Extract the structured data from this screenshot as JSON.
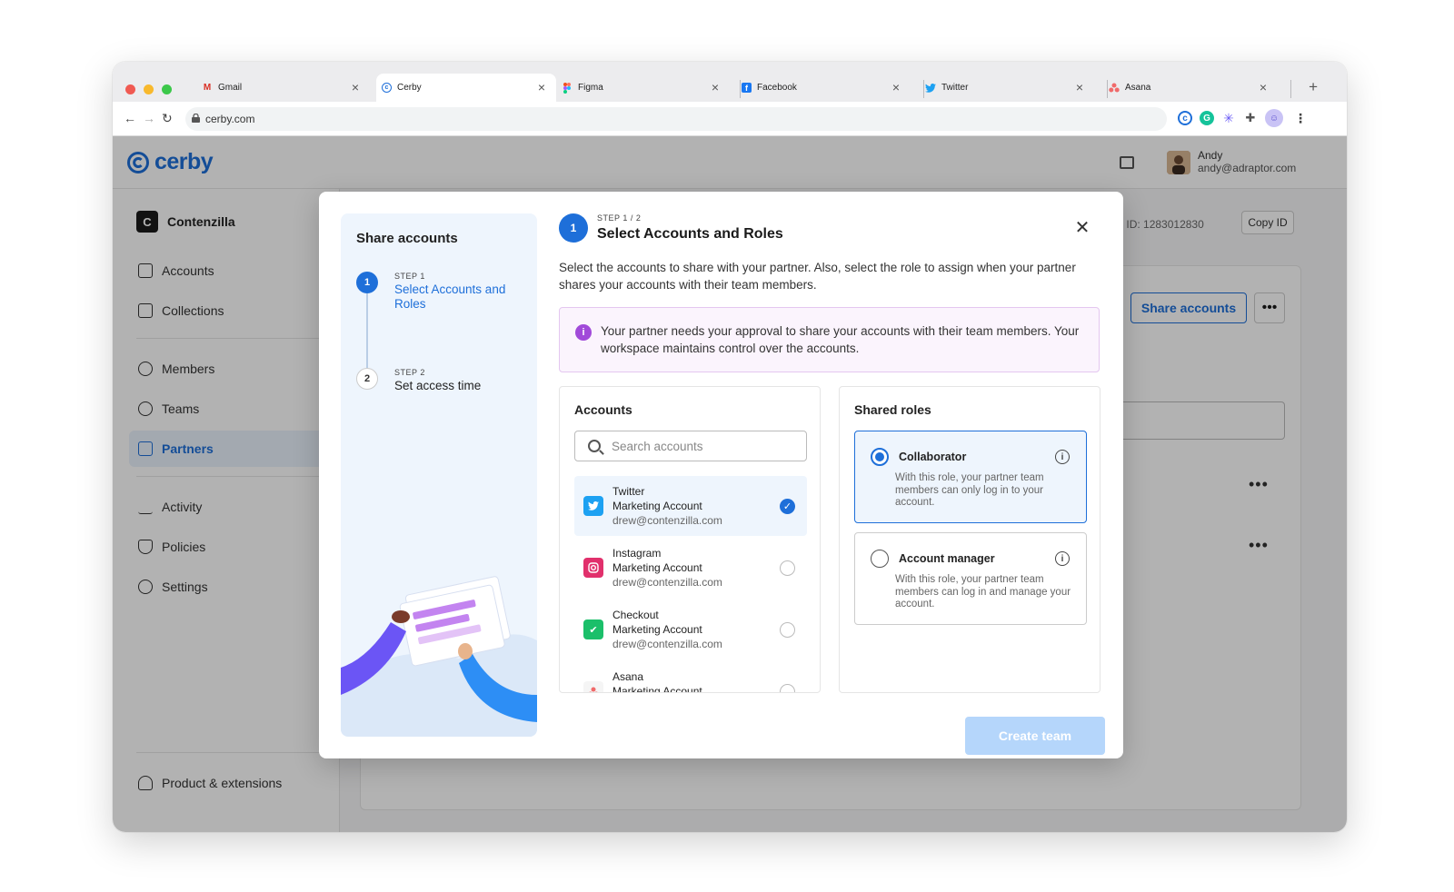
{
  "browser": {
    "tabs": [
      {
        "label": "Gmail",
        "favicon": "gmail-icon"
      },
      {
        "label": "Cerby",
        "favicon": "cerby-icon"
      },
      {
        "label": "Figma",
        "favicon": "figma-icon"
      },
      {
        "label": "Facebook",
        "favicon": "facebook-icon"
      },
      {
        "label": "Twitter",
        "favicon": "twitter-icon"
      },
      {
        "label": "Asana",
        "favicon": "asana-icon"
      }
    ],
    "new_tab": "+",
    "url": "cerby.com"
  },
  "app": {
    "logo": "cerby",
    "user": {
      "name": "Andy",
      "email": "andy@adraptor.com"
    },
    "workspace": {
      "badge": "C",
      "name": "Contenzilla"
    },
    "nav": [
      {
        "label": "Accounts",
        "icon": "grid-icon"
      },
      {
        "label": "Collections",
        "icon": "collections-icon"
      },
      {
        "label": "Members",
        "icon": "user-icon"
      },
      {
        "label": "Teams",
        "icon": "teams-icon"
      },
      {
        "label": "Partners",
        "icon": "building-icon"
      },
      {
        "label": "Activity",
        "icon": "activity-icon"
      },
      {
        "label": "Policies",
        "icon": "shield-icon"
      },
      {
        "label": "Settings",
        "icon": "gear-icon"
      }
    ],
    "nav_footer": {
      "label": "Product & extensions",
      "icon": "lightbulb-icon"
    },
    "workspace_id": "kspace ID: 1283012830",
    "copy_id": "Copy ID",
    "share_accounts": "Share accounts",
    "more": "•••"
  },
  "modal": {
    "steps_title": "Share accounts",
    "steps": [
      {
        "number": "1",
        "small": "STEP 1",
        "label": "Select Accounts and Roles"
      },
      {
        "number": "2",
        "small": "STEP 2",
        "label": "Set access time"
      }
    ],
    "header": {
      "number": "1",
      "step": "STEP 1 / 2",
      "title": "Select Accounts and Roles"
    },
    "close": "✕",
    "description": "Select the accounts to share with your partner. Also, select the role to assign when your partner shares your accounts with their team members.",
    "alert": {
      "icon": "i",
      "text": "Your partner needs your approval to share your accounts with their team members. Your workspace maintains control over the accounts."
    },
    "accounts": {
      "title": "Accounts",
      "search_placeholder": "Search accounts",
      "items": [
        {
          "name": "Twitter",
          "type": "Marketing Account",
          "email": "drew@contenzilla.com",
          "icon": "twitter-icon",
          "color": "#1da1f2",
          "selected": true
        },
        {
          "name": "Instagram",
          "type": "Marketing Account",
          "email": "drew@contenzilla.com",
          "icon": "instagram-icon",
          "color": "#e1306c",
          "selected": false
        },
        {
          "name": "Checkout",
          "type": "Marketing Account",
          "email": "drew@contenzilla.com",
          "icon": "checkout-icon",
          "color": "#1bbf6a",
          "selected": false
        },
        {
          "name": "Asana",
          "type": "Marketing Account",
          "email": "",
          "icon": "asana-icon",
          "color": "#f06a6a",
          "selected": false
        }
      ]
    },
    "roles": {
      "title": "Shared roles",
      "items": [
        {
          "name": "Collaborator",
          "description": "With this role, your partner team members can only log in to your account.",
          "selected": true
        },
        {
          "name": "Account manager",
          "description": "With this role, your partner team members can log in and manage your account.",
          "selected": false
        }
      ]
    },
    "create_button": "Create team"
  },
  "colors": {
    "accent": "#1e6fd9",
    "alert_bg": "#fbf4fd",
    "alert_icon": "#a14ad9",
    "disabled_button": "#b5d6fb"
  }
}
